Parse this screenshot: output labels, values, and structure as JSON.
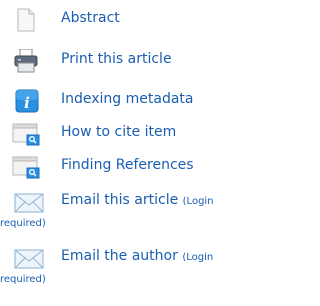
{
  "tools": {
    "abstract": {
      "label": "Abstract",
      "icon": "document-icon"
    },
    "print": {
      "label": "Print this article",
      "icon": "printer-icon"
    },
    "indexing": {
      "label": "Indexing metadata",
      "icon": "info-icon"
    },
    "cite": {
      "label": "How to cite item",
      "icon": "search-page-icon"
    },
    "references": {
      "label": "Finding References",
      "icon": "search-page-icon"
    },
    "email_article": {
      "label": "Email this article",
      "note_line1": "(Login",
      "note_line2": "required)",
      "icon": "envelope-icon"
    },
    "email_author": {
      "label": "Email the author",
      "note_line1": "(Login",
      "note_line2": "required)",
      "icon": "envelope-icon"
    }
  },
  "colors": {
    "link": "#1a5eb0"
  }
}
